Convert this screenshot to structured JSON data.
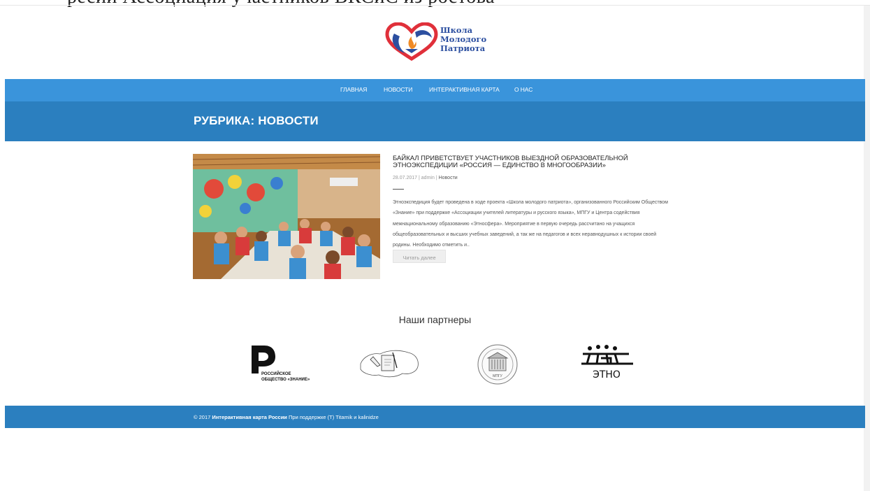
{
  "top_partial_text": "ресии Ассоциация участников ВКСиС из ростова",
  "logo": {
    "line1": "Школа",
    "line2": "Молодого",
    "line3": "Патриота"
  },
  "nav": {
    "items": [
      {
        "label": "ГЛАВНАЯ"
      },
      {
        "label": "НОВОСТИ"
      },
      {
        "label": "ИНТЕРАКТИВНАЯ КАРТА"
      },
      {
        "label": "О НАС"
      }
    ]
  },
  "rubric": {
    "title": "РУБРИКА: НОВОСТИ"
  },
  "post": {
    "title": "БАЙКАЛ ПРИВЕТСТВУЕТ УЧАСТНИКОВ ВЫЕЗДНОЙ ОБРАЗОВАТЕЛЬНОЙ ЭТНОЭКСПЕДИЦИИ «РОССИЯ — ЕДИНСТВО В МНОГООБРАЗИИ»",
    "date": "28.07.2017",
    "author": "admin",
    "category": "Новости",
    "separator": "|",
    "excerpt": "Этноэкспедиция будет проведена в ходе проекта «Школа молодого патриота», организованного Российским Обществом «Знание» при поддержке «Ассоциации учителей литературы и русского языка», МПГУ и Центра содействия межнациональному образованию «Этносфера». Мероприятие в первую очередь рассчитано на учащихся общеобразовательных и высших учебных заведений, а так же на педагогов и всех неравнодушных к истории своей родины. Необходимо отметить и..",
    "read_more": "Читать далее"
  },
  "partners": {
    "heading": "Наши партнеры",
    "items": [
      {
        "name": "znanie",
        "caption_line1": "РОССИЙСКОЕ",
        "caption_line2": "ОБЩЕСТВО «ЗНАНИЕ»"
      },
      {
        "name": "teachers-association"
      },
      {
        "name": "mpgu",
        "seal_text": "МПГУ"
      },
      {
        "name": "etno",
        "caption": "ЭТНО"
      }
    ]
  },
  "footer": {
    "copyright": "© 2017",
    "site_name": "Интерактивная карта России",
    "support_text": "При поддержке (Т) Titamik и kalinidze"
  },
  "colors": {
    "nav_bg": "#3a94db",
    "band_bg": "#2b7fbf",
    "logo_blue": "#2c4fa0",
    "logo_red": "#e0303a"
  }
}
